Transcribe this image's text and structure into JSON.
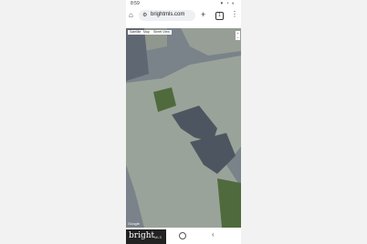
{
  "status_bar": {
    "time": "8:59",
    "icons": "▾ ◔ ◐"
  },
  "browser": {
    "url": "brightmls.com",
    "tab_count": "1",
    "home_icon": "home-icon",
    "tune_icon": "tune-icon",
    "plus_icon": "plus-icon",
    "more_icon": "more-icon"
  },
  "map": {
    "tabs": [
      "Satellite",
      "Map",
      "Street View"
    ],
    "zoom_in": "+",
    "zoom_out": "−",
    "attribution": "Google"
  },
  "footer": {
    "brand": "bright",
    "brand_suffix": "MLS"
  },
  "colors": {
    "water": "#5f6872",
    "land": "#9aa39a",
    "green": "#4f6b3d"
  }
}
